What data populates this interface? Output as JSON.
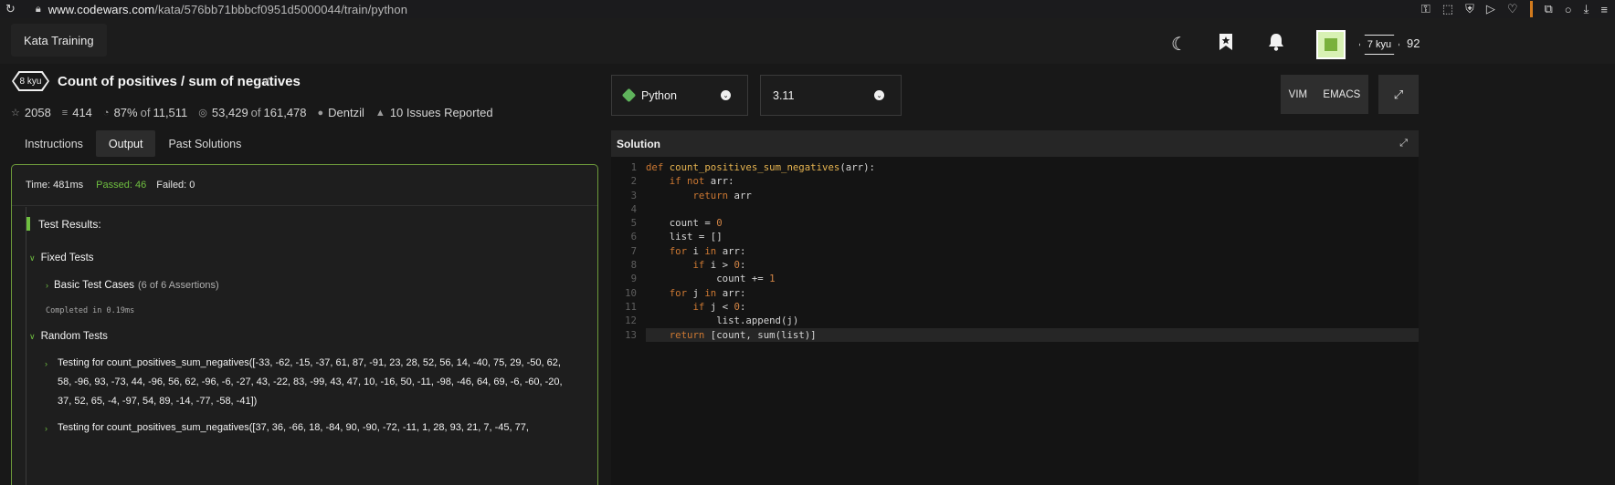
{
  "browser": {
    "url_domain": "www.codewars.com",
    "url_path": "/kata/576bb71bbbcf0951d5000044/train/python"
  },
  "topbar": {
    "section_label": "Kata Training",
    "rank": "7 kyu",
    "honor": "92"
  },
  "kata": {
    "kyu": "8 kyu",
    "title": "Count of positives / sum of negatives",
    "stats": {
      "stars": "2058",
      "collections": "414",
      "satisfaction_pct": "87%",
      "satisfaction_of_word": "of",
      "satisfaction_votes": "11,511",
      "completed": "53,429",
      "completed_of_word": "of",
      "attempted": "161,478",
      "author": "Dentzil",
      "issues": "10 Issues Reported"
    }
  },
  "tabs": [
    {
      "label": "Instructions"
    },
    {
      "label": "Output"
    },
    {
      "label": "Past Solutions"
    }
  ],
  "output": {
    "time": "Time: 481ms",
    "passed": "Passed: 46",
    "failed": "Failed: 0",
    "results_heading": "Test Results:",
    "fixed_tests": "Fixed Tests",
    "basic_case": "Basic Test Cases",
    "basic_case_assertions": "(6 of 6 Assertions)",
    "completed_time": "Completed in 0.19ms",
    "random_tests": "Random Tests",
    "random_cases": [
      "Testing for count_positives_sum_negatives([-33, -62, -15, -37, 61, 87, -91, 23, 28, 52, 56, 14, -40, 75, 29, -50, 62, 58, -96, 93, -73, 44, -96, 56, 62, -96, -6, -27, 43, -22, 83, -99, 43, 47, 10, -16, 50, -11, -98, -46, 64, 69, -6, -60, -20, 37, 52, 65, -4, -97, 54, 89, -14, -77, -58, -41])",
      "Testing for count_positives_sum_negatives([37, 36, -66, 18, -84, 90, -90, -72, -11, 1, 28, 93, 21, 7, -45, 77,"
    ]
  },
  "editor": {
    "language": "Python",
    "version": "3.11",
    "mode_vim": "VIM",
    "mode_emacs": "EMACS",
    "panel_title": "Solution",
    "line_numbers": [
      "1",
      "2",
      "3",
      "4",
      "5",
      "6",
      "7",
      "8",
      "9",
      "10",
      "11",
      "12",
      "13"
    ]
  },
  "colors": {
    "passed": "#6fbf40",
    "panel_border": "#6e9b3b",
    "keyword": "#cc7832",
    "function_name": "#e6b450",
    "background": "#181818"
  },
  "icons": [
    "reload-icon",
    "lock-icon",
    "moon-icon",
    "bookmark-icon",
    "bell-icon",
    "python-icon",
    "chevron-down-icon",
    "expand-icon",
    "star-icon",
    "layers-icon",
    "eye-icon",
    "target-icon",
    "user-icon",
    "warning-icon"
  ]
}
